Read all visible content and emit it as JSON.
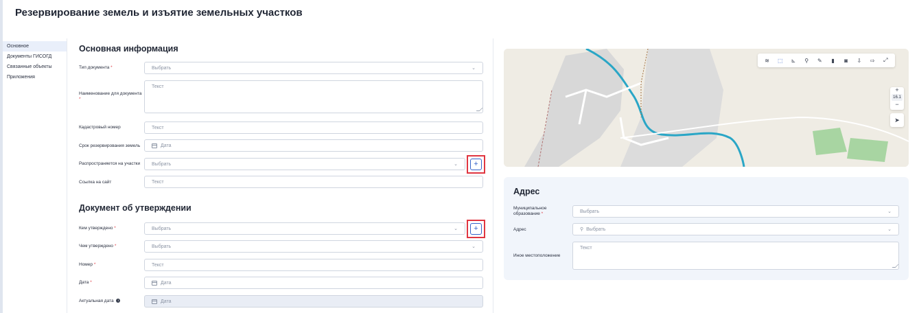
{
  "page": {
    "title": "Резервирование земель и изъятие земельных участков"
  },
  "sidebar": {
    "items": [
      {
        "label": "Основное"
      },
      {
        "label": "Документы ГИСОГД"
      },
      {
        "label": "Связанные объекты"
      },
      {
        "label": "Приложения"
      }
    ]
  },
  "main_info": {
    "title": "Основная информация",
    "doc_type": {
      "label": "Тип документа",
      "value": "Выбрать"
    },
    "doc_name": {
      "label": "Наименование для документа",
      "placeholder": "Текст"
    },
    "cadastral": {
      "label": "Кадастровый номер",
      "placeholder": "Текст"
    },
    "reserve_term": {
      "label": "Срок резервирования земель",
      "placeholder": "Дата"
    },
    "applies_to": {
      "label": "Распространяется на участки",
      "value": "Выбрать"
    },
    "site_link": {
      "label": "Ссылка на сайт",
      "placeholder": "Текст"
    }
  },
  "approval": {
    "title": "Документ об утверждении",
    "approved_by": {
      "label": "Кем утверждено",
      "value": "Выбрать"
    },
    "approved_with": {
      "label": "Чем утверждено",
      "value": "Выбрать"
    },
    "number": {
      "label": "Номер",
      "placeholder": "Текст"
    },
    "date": {
      "label": "Дата",
      "placeholder": "Дата"
    },
    "actual_date": {
      "label": "Актуальная дата",
      "placeholder": "Дата"
    }
  },
  "map": {
    "zoom_level": "16.1",
    "toolbar_icons": [
      "layers-icon",
      "select-area-icon",
      "ruler-icon",
      "search-icon",
      "pencil-icon",
      "trash-icon",
      "camera-icon",
      "import-icon",
      "export-icon",
      "fullscreen-icon"
    ],
    "colors": {
      "water": "#2aa6c6",
      "forest": "#a8d5a2",
      "urban": "#d8d8d8"
    }
  },
  "address": {
    "title": "Адрес",
    "municipality": {
      "label": "Муниципальное образование",
      "value": "Выбрать"
    },
    "address": {
      "label": "Адрес",
      "placeholder": "Выбрать"
    },
    "other_location": {
      "label": "Иное местоположение",
      "placeholder": "Текст"
    }
  },
  "glyphs": {
    "required": "*",
    "plus": "+",
    "chevron": "⌄",
    "search": "⚲",
    "zoom_in": "+",
    "zoom_out": "−",
    "locate": "➤"
  },
  "colors": {
    "accent": "#3563c9",
    "required": "#e0424a",
    "highlight": "#e03540"
  }
}
